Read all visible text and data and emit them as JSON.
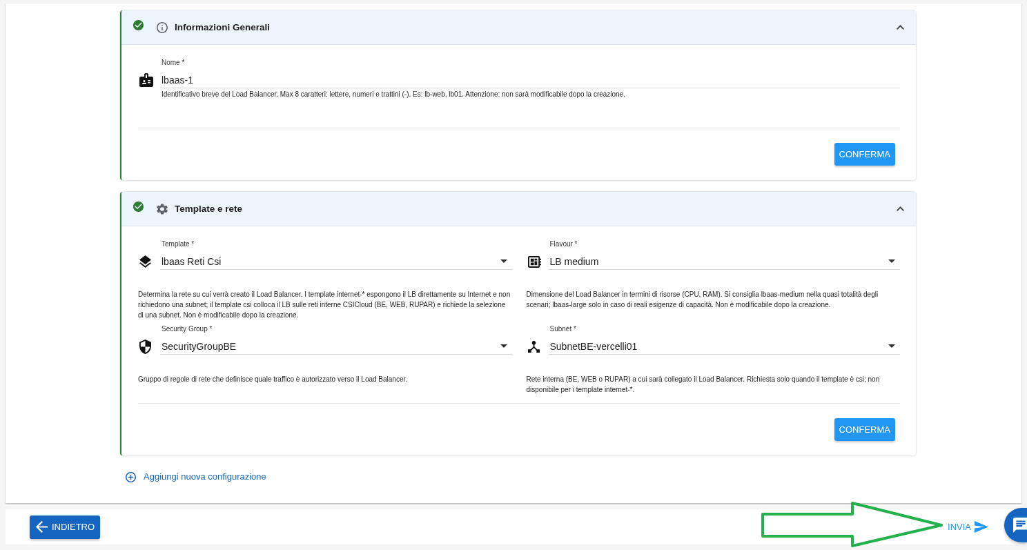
{
  "sections": [
    {
      "title": "Informazioni Generali",
      "completed": true,
      "expanded": true,
      "fields": [
        {
          "kind": "text",
          "label": "Nome *",
          "value": "lbaas-1",
          "helper": "Identificativo breve del Load Balancer. Max 8 caratteri: lettere, numeri e trattini (-). Es: lb-web, lb01. Attenzione: non sarà modificabile dopo la creazione."
        }
      ],
      "confirm_button": "CONFERMA"
    },
    {
      "title": "Template e rete",
      "completed": true,
      "expanded": true,
      "fields": [
        {
          "kind": "select",
          "label": "Template *",
          "value": "lbaas Reti Csi",
          "helper": "Determina la rete su cui verrà creato il Load Balancer. I template internet-* espongono il LB direttamente su Internet e non richiedono una subnet; il template csi colloca il LB sulle reti interne CSICloud (BE, WEB, RUPAR) e richiede la selezione di una subnet. Non è modificabile dopo la creazione."
        },
        {
          "kind": "select",
          "label": "Flavour *",
          "value": "LB medium",
          "helper": "Dimensione del Load Balancer in termini di risorse (CPU, RAM). Si consiglia lbaas-medium nella quasi totalità degli scenari; lbaas-large solo in caso di reali esigenze di capacità. Non è modificabile dopo la creazione."
        },
        {
          "kind": "select",
          "label": "Security Group *",
          "value": "SecurityGroupBE",
          "helper": "Gruppo di regole di rete che definisce quale traffico è autorizzato verso il Load Balancer."
        },
        {
          "kind": "select",
          "label": "Subnet *",
          "value": "SubnetBE-vercelli01",
          "helper": "Rete interna (BE, WEB o RUPAR) a cui sarà collegato il Load Balancer. Richiesta solo quando il template è csi; non disponibile per i template internet-*."
        }
      ],
      "confirm_button": "CONFERMA"
    }
  ],
  "add_link": "Aggiungi nuova configurazione",
  "footer": {
    "back_button": "INDIETRO",
    "submit_button": "INVIA"
  },
  "annotations": [
    {
      "kind": "arrow"
    }
  ]
}
